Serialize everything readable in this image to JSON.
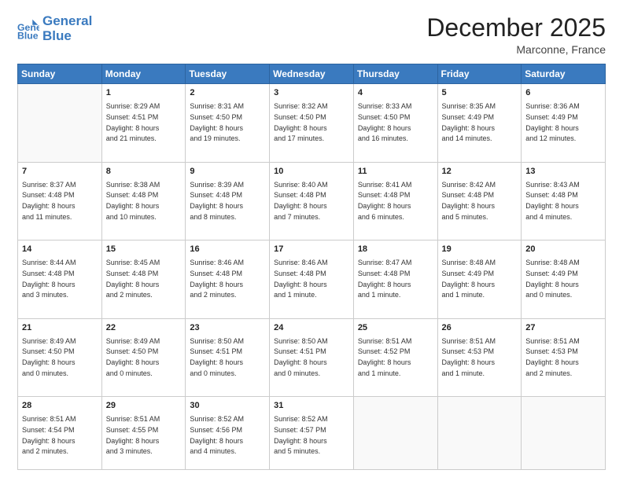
{
  "header": {
    "logo_line1": "General",
    "logo_line2": "Blue",
    "month": "December 2025",
    "location": "Marconne, France"
  },
  "weekdays": [
    "Sunday",
    "Monday",
    "Tuesday",
    "Wednesday",
    "Thursday",
    "Friday",
    "Saturday"
  ],
  "weeks": [
    [
      {
        "day": "",
        "text": ""
      },
      {
        "day": "1",
        "text": "Sunrise: 8:29 AM\nSunset: 4:51 PM\nDaylight: 8 hours\nand 21 minutes."
      },
      {
        "day": "2",
        "text": "Sunrise: 8:31 AM\nSunset: 4:50 PM\nDaylight: 8 hours\nand 19 minutes."
      },
      {
        "day": "3",
        "text": "Sunrise: 8:32 AM\nSunset: 4:50 PM\nDaylight: 8 hours\nand 17 minutes."
      },
      {
        "day": "4",
        "text": "Sunrise: 8:33 AM\nSunset: 4:50 PM\nDaylight: 8 hours\nand 16 minutes."
      },
      {
        "day": "5",
        "text": "Sunrise: 8:35 AM\nSunset: 4:49 PM\nDaylight: 8 hours\nand 14 minutes."
      },
      {
        "day": "6",
        "text": "Sunrise: 8:36 AM\nSunset: 4:49 PM\nDaylight: 8 hours\nand 12 minutes."
      }
    ],
    [
      {
        "day": "7",
        "text": "Sunrise: 8:37 AM\nSunset: 4:48 PM\nDaylight: 8 hours\nand 11 minutes."
      },
      {
        "day": "8",
        "text": "Sunrise: 8:38 AM\nSunset: 4:48 PM\nDaylight: 8 hours\nand 10 minutes."
      },
      {
        "day": "9",
        "text": "Sunrise: 8:39 AM\nSunset: 4:48 PM\nDaylight: 8 hours\nand 8 minutes."
      },
      {
        "day": "10",
        "text": "Sunrise: 8:40 AM\nSunset: 4:48 PM\nDaylight: 8 hours\nand 7 minutes."
      },
      {
        "day": "11",
        "text": "Sunrise: 8:41 AM\nSunset: 4:48 PM\nDaylight: 8 hours\nand 6 minutes."
      },
      {
        "day": "12",
        "text": "Sunrise: 8:42 AM\nSunset: 4:48 PM\nDaylight: 8 hours\nand 5 minutes."
      },
      {
        "day": "13",
        "text": "Sunrise: 8:43 AM\nSunset: 4:48 PM\nDaylight: 8 hours\nand 4 minutes."
      }
    ],
    [
      {
        "day": "14",
        "text": "Sunrise: 8:44 AM\nSunset: 4:48 PM\nDaylight: 8 hours\nand 3 minutes."
      },
      {
        "day": "15",
        "text": "Sunrise: 8:45 AM\nSunset: 4:48 PM\nDaylight: 8 hours\nand 2 minutes."
      },
      {
        "day": "16",
        "text": "Sunrise: 8:46 AM\nSunset: 4:48 PM\nDaylight: 8 hours\nand 2 minutes."
      },
      {
        "day": "17",
        "text": "Sunrise: 8:46 AM\nSunset: 4:48 PM\nDaylight: 8 hours\nand 1 minute."
      },
      {
        "day": "18",
        "text": "Sunrise: 8:47 AM\nSunset: 4:48 PM\nDaylight: 8 hours\nand 1 minute."
      },
      {
        "day": "19",
        "text": "Sunrise: 8:48 AM\nSunset: 4:49 PM\nDaylight: 8 hours\nand 1 minute."
      },
      {
        "day": "20",
        "text": "Sunrise: 8:48 AM\nSunset: 4:49 PM\nDaylight: 8 hours\nand 0 minutes."
      }
    ],
    [
      {
        "day": "21",
        "text": "Sunrise: 8:49 AM\nSunset: 4:50 PM\nDaylight: 8 hours\nand 0 minutes."
      },
      {
        "day": "22",
        "text": "Sunrise: 8:49 AM\nSunset: 4:50 PM\nDaylight: 8 hours\nand 0 minutes."
      },
      {
        "day": "23",
        "text": "Sunrise: 8:50 AM\nSunset: 4:51 PM\nDaylight: 8 hours\nand 0 minutes."
      },
      {
        "day": "24",
        "text": "Sunrise: 8:50 AM\nSunset: 4:51 PM\nDaylight: 8 hours\nand 0 minutes."
      },
      {
        "day": "25",
        "text": "Sunrise: 8:51 AM\nSunset: 4:52 PM\nDaylight: 8 hours\nand 1 minute."
      },
      {
        "day": "26",
        "text": "Sunrise: 8:51 AM\nSunset: 4:53 PM\nDaylight: 8 hours\nand 1 minute."
      },
      {
        "day": "27",
        "text": "Sunrise: 8:51 AM\nSunset: 4:53 PM\nDaylight: 8 hours\nand 2 minutes."
      }
    ],
    [
      {
        "day": "28",
        "text": "Sunrise: 8:51 AM\nSunset: 4:54 PM\nDaylight: 8 hours\nand 2 minutes."
      },
      {
        "day": "29",
        "text": "Sunrise: 8:51 AM\nSunset: 4:55 PM\nDaylight: 8 hours\nand 3 minutes."
      },
      {
        "day": "30",
        "text": "Sunrise: 8:52 AM\nSunset: 4:56 PM\nDaylight: 8 hours\nand 4 minutes."
      },
      {
        "day": "31",
        "text": "Sunrise: 8:52 AM\nSunset: 4:57 PM\nDaylight: 8 hours\nand 5 minutes."
      },
      {
        "day": "",
        "text": ""
      },
      {
        "day": "",
        "text": ""
      },
      {
        "day": "",
        "text": ""
      }
    ]
  ]
}
